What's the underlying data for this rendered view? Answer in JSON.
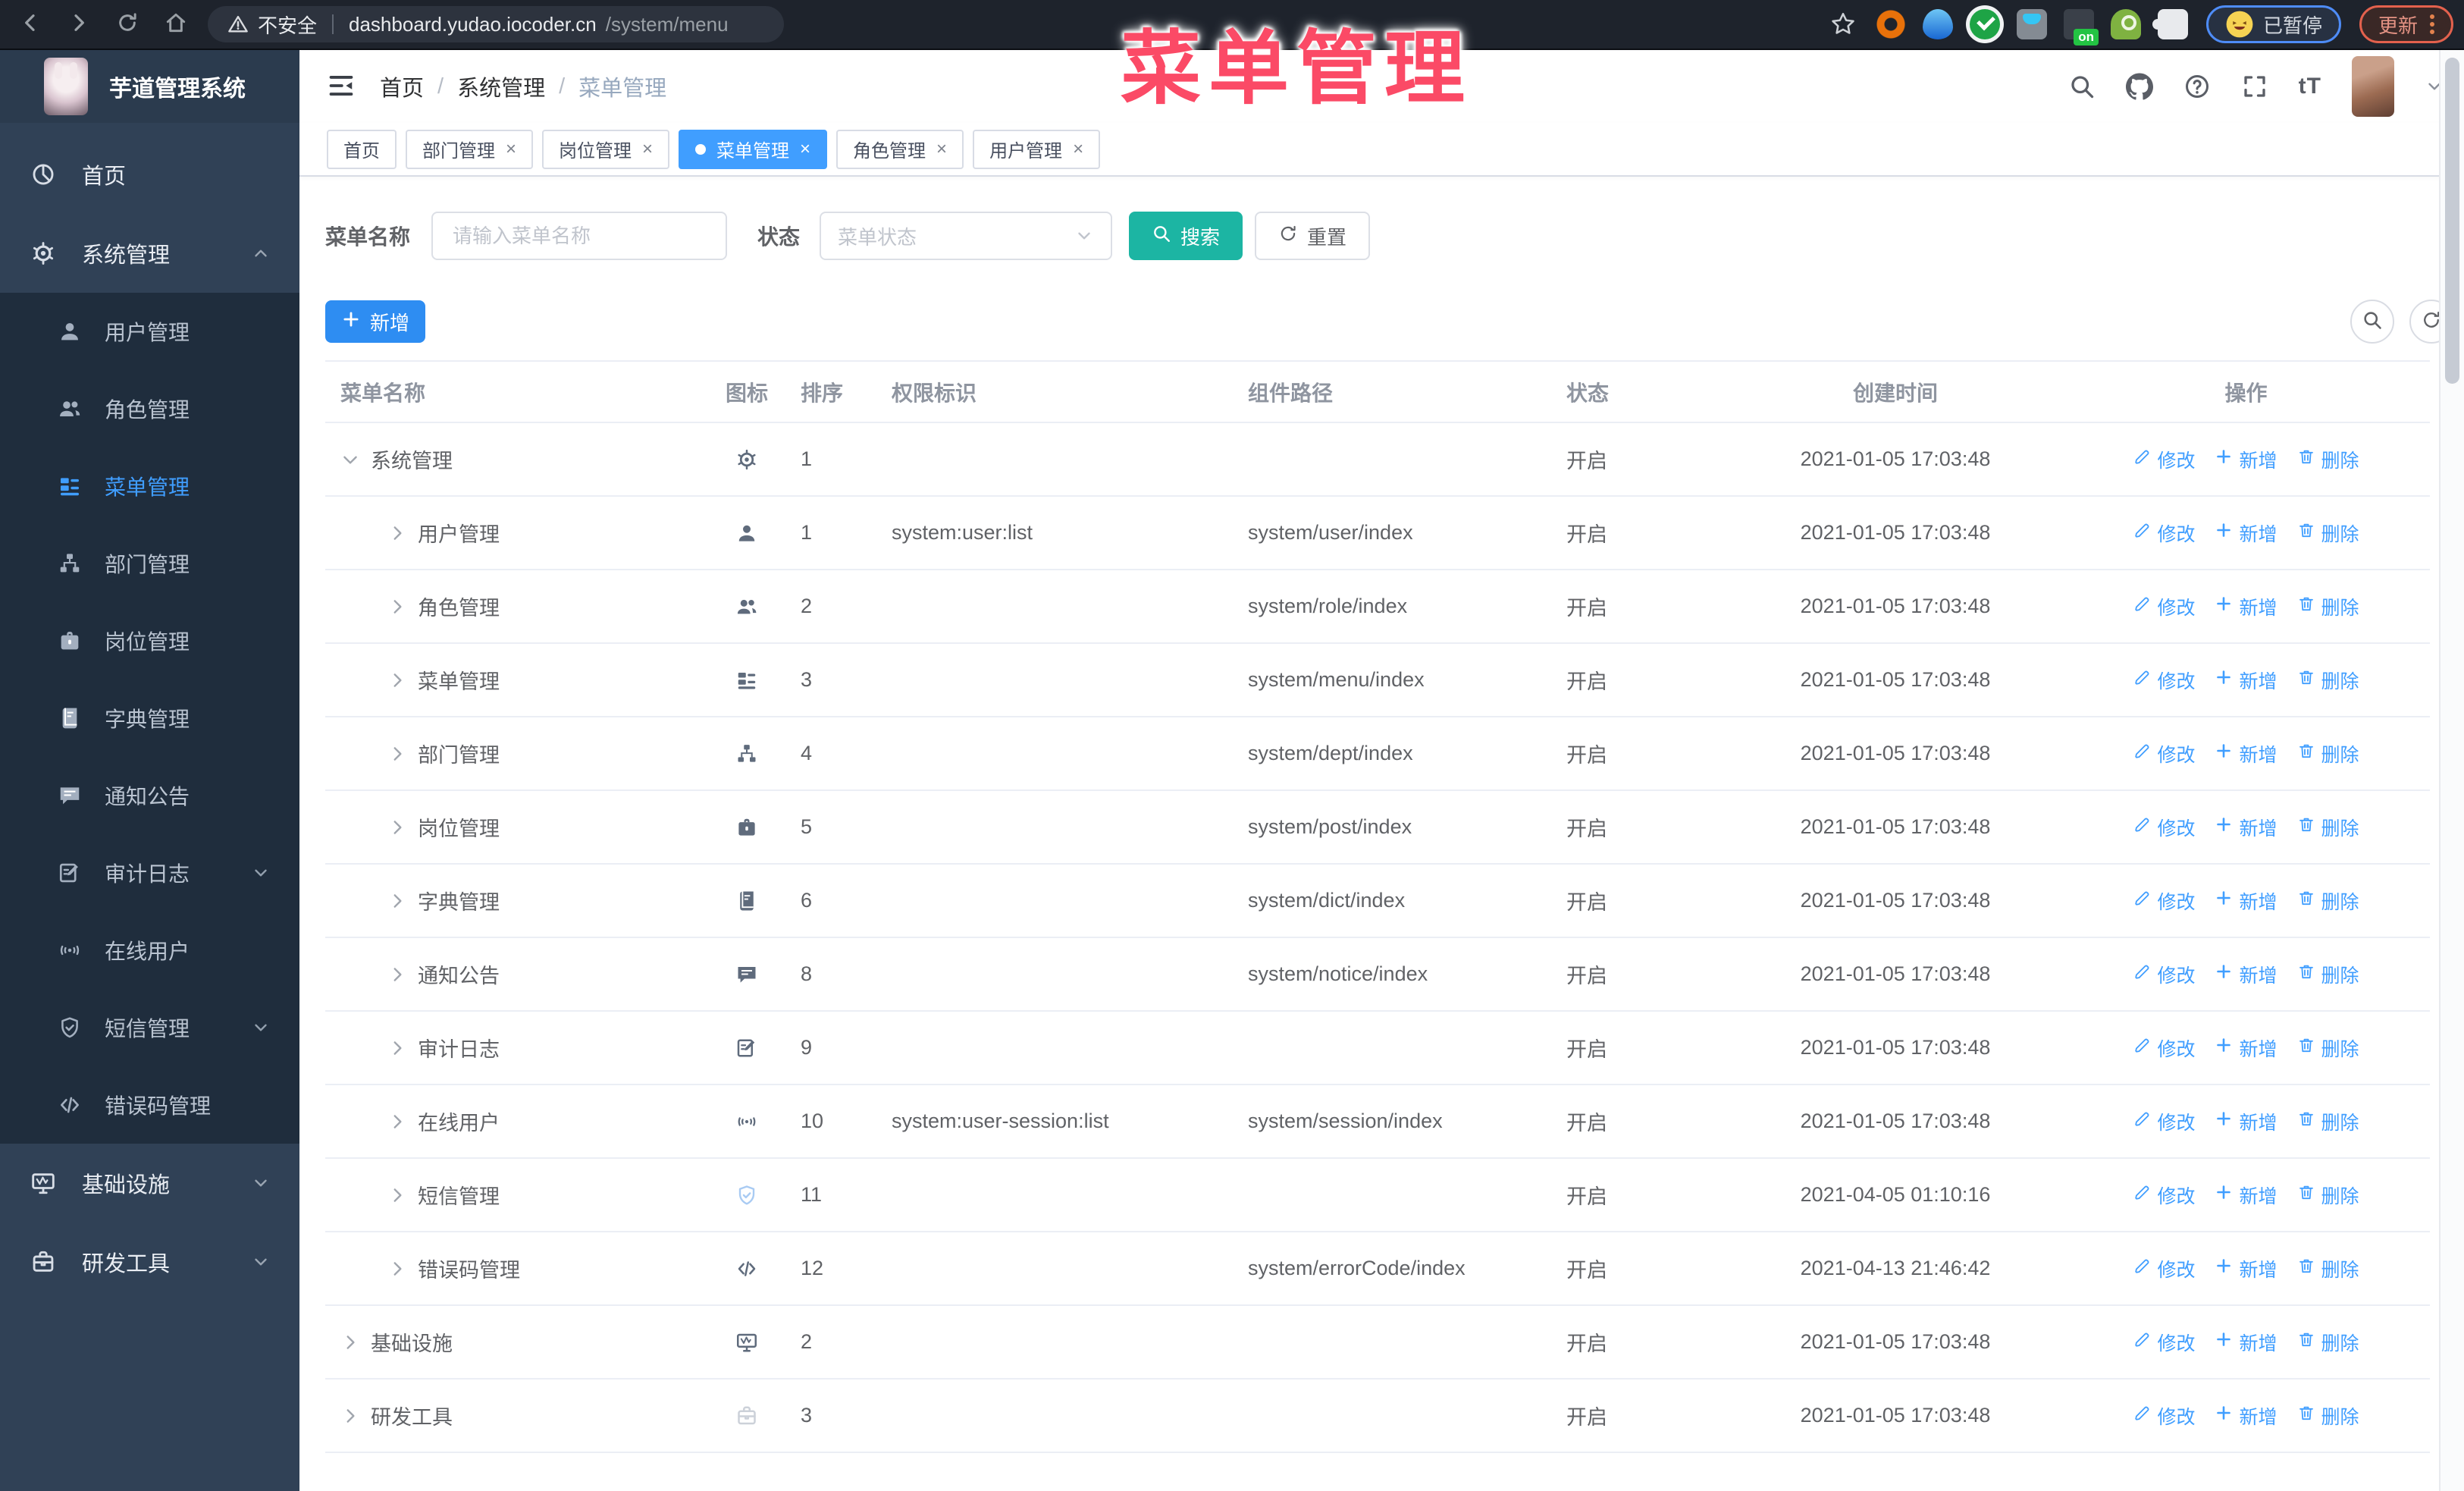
{
  "browser": {
    "security_label": "不安全",
    "url_host": "dashboard.yudao.iocoder.cn",
    "url_path": "/system/menu",
    "extensions": [
      "ext-ring",
      "ext-drop",
      "ext-check",
      "ext-grid",
      "ext-on",
      "ext-key",
      "ext-puzzle"
    ],
    "paused_label": "已暂停",
    "update_label": "更新"
  },
  "annotation": {
    "text": "菜单管理"
  },
  "sidebar": {
    "logo_title": "芋道管理系统",
    "top_items": [
      {
        "label": "首页",
        "icon": "dashboard"
      },
      {
        "label": "系统管理",
        "icon": "gear",
        "caret": "up"
      }
    ],
    "sub_items": [
      {
        "label": "用户管理",
        "icon": "user"
      },
      {
        "label": "角色管理",
        "icon": "peoples"
      },
      {
        "label": "菜单管理",
        "icon": "tree-table",
        "active": true
      },
      {
        "label": "部门管理",
        "icon": "tree"
      },
      {
        "label": "岗位管理",
        "icon": "post"
      },
      {
        "label": "字典管理",
        "icon": "dict"
      },
      {
        "label": "通知公告",
        "icon": "message"
      },
      {
        "label": "审计日志",
        "icon": "log",
        "caret": "down"
      },
      {
        "label": "在线用户",
        "icon": "online"
      },
      {
        "label": "短信管理",
        "icon": "valid-code",
        "caret": "down"
      },
      {
        "label": "错误码管理",
        "icon": "code"
      }
    ],
    "bottom_items": [
      {
        "label": "基础设施",
        "icon": "monitor",
        "caret": "down"
      },
      {
        "label": "研发工具",
        "icon": "skill",
        "caret": "down"
      }
    ]
  },
  "header": {
    "breadcrumb": [
      "首页",
      "系统管理",
      "菜单管理"
    ]
  },
  "tabs": [
    {
      "label": "首页",
      "closable": false,
      "active": false
    },
    {
      "label": "部门管理",
      "closable": true,
      "active": false
    },
    {
      "label": "岗位管理",
      "closable": true,
      "active": false
    },
    {
      "label": "菜单管理",
      "closable": true,
      "active": true
    },
    {
      "label": "角色管理",
      "closable": true,
      "active": false
    },
    {
      "label": "用户管理",
      "closable": true,
      "active": false
    }
  ],
  "filters": {
    "name_label": "菜单名称",
    "name_placeholder": "请输入菜单名称",
    "name_value": "",
    "status_label": "状态",
    "status_placeholder": "菜单状态",
    "search_label": "搜索",
    "reset_label": "重置"
  },
  "toolbar": {
    "add_label": "新增"
  },
  "table": {
    "columns": [
      "菜单名称",
      "图标",
      "排序",
      "权限标识",
      "组件路径",
      "状态",
      "创建时间",
      "操作"
    ],
    "op_labels": {
      "edit": "修改",
      "add": "新增",
      "delete": "删除"
    },
    "rows": [
      {
        "name": "系统管理",
        "icon": "gear",
        "level": 0,
        "expand": "down",
        "sort": "1",
        "perms": "",
        "path": "",
        "status": "开启",
        "time": "2021-01-05 17:03:48"
      },
      {
        "name": "用户管理",
        "icon": "user",
        "level": 1,
        "expand": "right",
        "sort": "1",
        "perms": "system:user:list",
        "path": "system/user/index",
        "status": "开启",
        "time": "2021-01-05 17:03:48"
      },
      {
        "name": "角色管理",
        "icon": "peoples",
        "level": 1,
        "expand": "right",
        "sort": "2",
        "perms": "",
        "path": "system/role/index",
        "status": "开启",
        "time": "2021-01-05 17:03:48"
      },
      {
        "name": "菜单管理",
        "icon": "tree-table",
        "level": 1,
        "expand": "right",
        "sort": "3",
        "perms": "",
        "path": "system/menu/index",
        "status": "开启",
        "time": "2021-01-05 17:03:48"
      },
      {
        "name": "部门管理",
        "icon": "tree",
        "level": 1,
        "expand": "right",
        "sort": "4",
        "perms": "",
        "path": "system/dept/index",
        "status": "开启",
        "time": "2021-01-05 17:03:48"
      },
      {
        "name": "岗位管理",
        "icon": "post",
        "level": 1,
        "expand": "right",
        "sort": "5",
        "perms": "",
        "path": "system/post/index",
        "status": "开启",
        "time": "2021-01-05 17:03:48"
      },
      {
        "name": "字典管理",
        "icon": "dict",
        "level": 1,
        "expand": "right",
        "sort": "6",
        "perms": "",
        "path": "system/dict/index",
        "status": "开启",
        "time": "2021-01-05 17:03:48"
      },
      {
        "name": "通知公告",
        "icon": "message",
        "level": 1,
        "expand": "right",
        "sort": "8",
        "perms": "",
        "path": "system/notice/index",
        "status": "开启",
        "time": "2021-01-05 17:03:48"
      },
      {
        "name": "审计日志",
        "icon": "log",
        "level": 1,
        "expand": "right",
        "sort": "9",
        "perms": "",
        "path": "",
        "status": "开启",
        "time": "2021-01-05 17:03:48"
      },
      {
        "name": "在线用户",
        "icon": "online",
        "level": 1,
        "expand": "right",
        "sort": "10",
        "perms": "system:user-session:list",
        "path": "system/session/index",
        "status": "开启",
        "time": "2021-01-05 17:03:48"
      },
      {
        "name": "短信管理",
        "icon": "valid-code",
        "level": 1,
        "expand": "right",
        "sort": "11",
        "perms": "",
        "path": "",
        "status": "开启",
        "time": "2021-04-05 01:10:16",
        "iconColor": "#a9cbf3"
      },
      {
        "name": "错误码管理",
        "icon": "code",
        "level": 1,
        "expand": "right",
        "sort": "12",
        "perms": "",
        "path": "system/errorCode/index",
        "status": "开启",
        "time": "2021-04-13 21:46:42"
      },
      {
        "name": "基础设施",
        "icon": "monitor",
        "level": 0,
        "expand": "right",
        "sort": "2",
        "perms": "",
        "path": "",
        "status": "开启",
        "time": "2021-01-05 17:03:48"
      },
      {
        "name": "研发工具",
        "icon": "skill",
        "level": 0,
        "expand": "right",
        "sort": "3",
        "perms": "",
        "path": "",
        "status": "开启",
        "time": "2021-01-05 17:03:48",
        "iconColor": "#ccd1d9"
      }
    ]
  }
}
